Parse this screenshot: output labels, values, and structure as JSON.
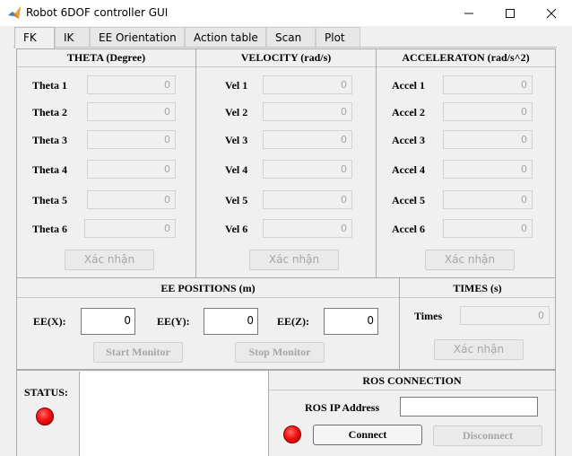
{
  "window": {
    "title": "Robot 6DOF controller GUI",
    "minimize": "—",
    "maximize": "☐",
    "close": "✕"
  },
  "tabs": [
    {
      "label": "FK",
      "active": true
    },
    {
      "label": "IK",
      "active": false
    },
    {
      "label": "EE Orientation",
      "active": false
    },
    {
      "label": "Action table",
      "active": false
    },
    {
      "label": "Scan",
      "active": false
    },
    {
      "label": "Plot",
      "active": false
    }
  ],
  "theta": {
    "title": "THETA (Degree)",
    "rows": [
      {
        "label": "Theta 1",
        "value": "0"
      },
      {
        "label": "Theta  2",
        "value": "0"
      },
      {
        "label": "Theta 3",
        "value": "0"
      },
      {
        "label": "Theta 4",
        "value": "0"
      },
      {
        "label": "Theta 5",
        "value": "0"
      },
      {
        "label": "Theta 6",
        "value": "0"
      }
    ],
    "confirm": "Xác nhận"
  },
  "velocity": {
    "title": "VELOCITY (rad/s)",
    "rows": [
      {
        "label": "Vel 1",
        "value": "0"
      },
      {
        "label": "Vel 2",
        "value": "0"
      },
      {
        "label": "Vel 3",
        "value": "0"
      },
      {
        "label": "Vel 4",
        "value": "0"
      },
      {
        "label": "Vel 5",
        "value": "0"
      },
      {
        "label": "Vel 6",
        "value": "0"
      }
    ],
    "confirm": "Xác nhận"
  },
  "acceleration": {
    "title": "ACCELERATON (rad/s^2)",
    "rows": [
      {
        "label": "Accel 1",
        "value": "0"
      },
      {
        "label": "Accel 2",
        "value": "0"
      },
      {
        "label": "Accel 3",
        "value": "0"
      },
      {
        "label": "Accel 4",
        "value": "0"
      },
      {
        "label": "Accel 5",
        "value": "0"
      },
      {
        "label": "Accel 6",
        "value": "0"
      }
    ],
    "confirm": "Xác nhận"
  },
  "ee_positions": {
    "title": "EE POSITIONS (m)",
    "x_label": "EE(X):",
    "x_value": "0",
    "y_label": "EE(Y):",
    "y_value": "0",
    "z_label": "EE(Z):",
    "z_value": "0",
    "start": "Start Monitor",
    "stop": "Stop Monitor"
  },
  "times": {
    "title": "TIMES (s)",
    "label": "Times",
    "value": "0",
    "confirm": "Xác nhận"
  },
  "status": {
    "label": "STATUS:",
    "led_color": "#f21212",
    "text": ""
  },
  "ros": {
    "title": "ROS CONNECTION",
    "ip_label": "ROS IP Address",
    "ip_value": "",
    "connect": "Connect",
    "disconnect": "Disconnect",
    "led_color": "#f21212"
  }
}
